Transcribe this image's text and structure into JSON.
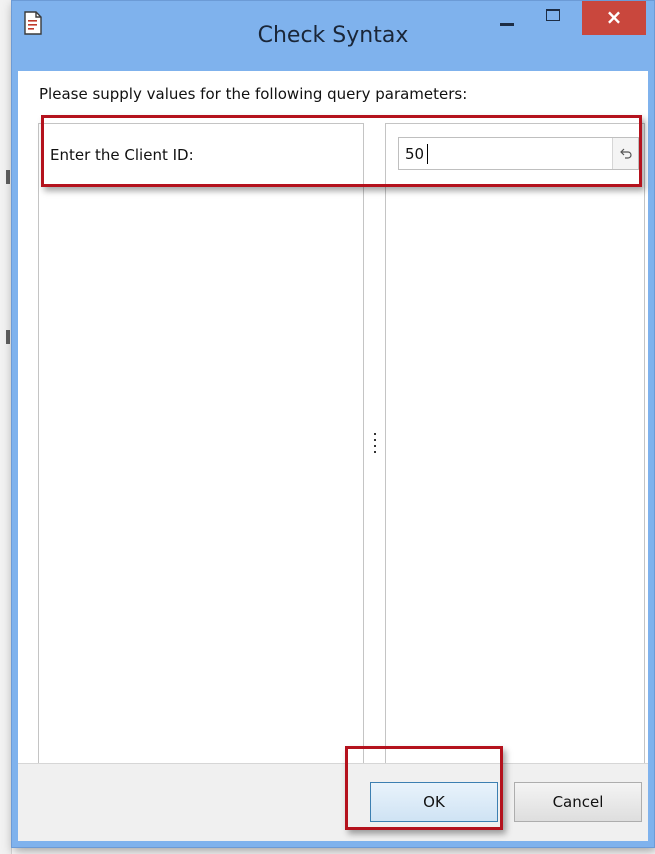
{
  "window": {
    "title": "Check Syntax",
    "close_glyph": "×",
    "icon": "document-icon"
  },
  "prompt_text": "Please supply values for the following query parameters:",
  "parameter": {
    "label": "Enter the Client ID:",
    "value": "50",
    "reset_icon": "undo-icon"
  },
  "buttons": {
    "ok_label": "OK",
    "cancel_label": "Cancel"
  },
  "colors": {
    "titlebar": "#7fb2ed",
    "close_button": "#c9473d",
    "highlight": "#b4121d"
  }
}
